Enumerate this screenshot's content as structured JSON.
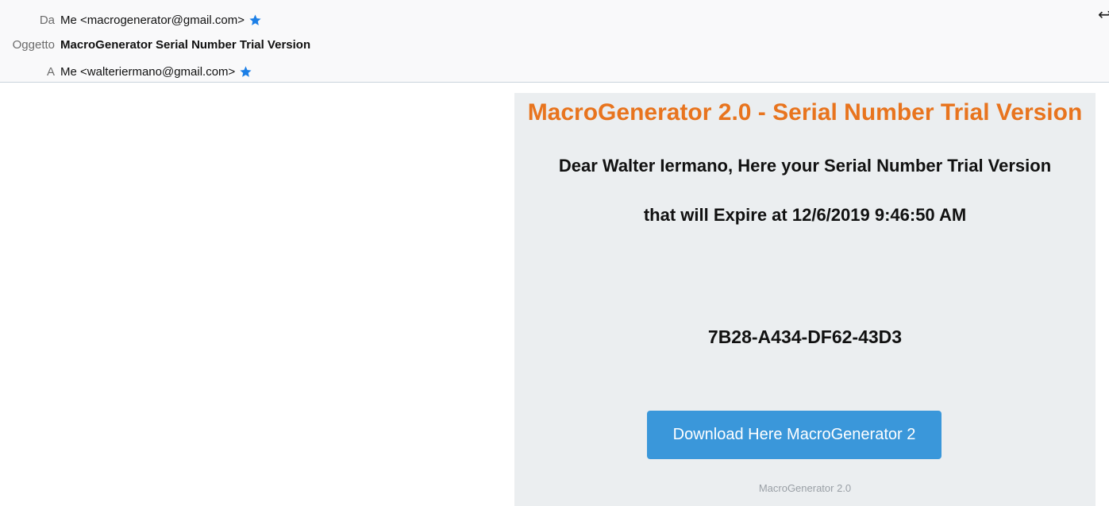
{
  "header": {
    "from": {
      "label": "Da",
      "value": "Me <macrogenerator@gmail.com>",
      "starred": true
    },
    "subject": {
      "label": "Oggetto",
      "value": "MacroGenerator Serial Number Trial Version"
    },
    "to": {
      "label": "A",
      "value": "Me <walteriermano@gmail.com>",
      "starred": true
    },
    "reply_icon": "reply-icon"
  },
  "body": {
    "title": "MacroGenerator 2.0 - Serial Number Trial Version",
    "greeting": "Dear Walter Iermano, Here your Serial Number Trial Version",
    "expiry": "that will Expire at 12/6/2019 9:46:50 AM",
    "serial_number": "7B28-A434-DF62-43D3",
    "download_button": "Download Here MacroGenerator 2",
    "footer": "MacroGenerator 2.0"
  },
  "colors": {
    "title": "#e8741e",
    "button": "#3a97da",
    "star": "#1c7fe6",
    "card_background": "#ebeef0"
  }
}
